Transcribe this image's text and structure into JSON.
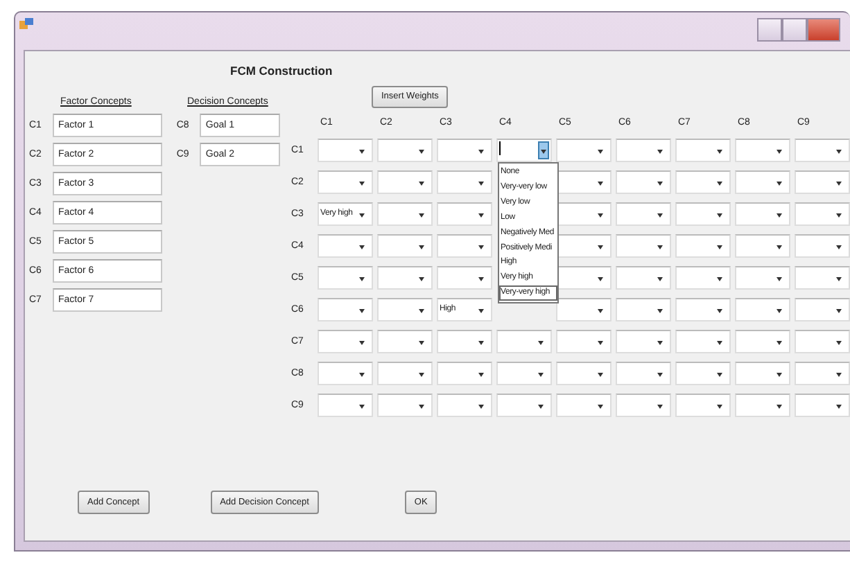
{
  "heading": "FCM Construction",
  "factor_concepts": {
    "header": "Factor Concepts",
    "items": [
      {
        "label": "C1",
        "value": "Factor 1"
      },
      {
        "label": "C2",
        "value": "Factor 2"
      },
      {
        "label": "C3",
        "value": "Factor 3"
      },
      {
        "label": "C4",
        "value": "Factor 4"
      },
      {
        "label": "C5",
        "value": "Factor 5"
      },
      {
        "label": "C6",
        "value": "Factor 6"
      },
      {
        "label": "C7",
        "value": "Factor 7"
      }
    ]
  },
  "decision_concepts": {
    "header": "Decision Concepts",
    "items": [
      {
        "label": "C8",
        "value": "Goal 1"
      },
      {
        "label": "C9",
        "value": "Goal 2"
      }
    ]
  },
  "weights": {
    "button": "Insert Weights",
    "columns": [
      "C1",
      "C2",
      "C3",
      "C4",
      "C5",
      "C6",
      "C7",
      "C8",
      "C9"
    ],
    "rows": [
      {
        "label": "C1",
        "cells": [
          {},
          {},
          {},
          {
            "open": true
          },
          {},
          {},
          {},
          {},
          {}
        ]
      },
      {
        "label": "C2",
        "cells": [
          {},
          {},
          {},
          null,
          {},
          {},
          {},
          {},
          {}
        ]
      },
      {
        "label": "C3",
        "cells": [
          {
            "value": "Very high"
          },
          {},
          {},
          null,
          {},
          {},
          {},
          {},
          {}
        ]
      },
      {
        "label": "C4",
        "cells": [
          {},
          {},
          {},
          null,
          {},
          {},
          {},
          {},
          {}
        ]
      },
      {
        "label": "C5",
        "cells": [
          {},
          {},
          {},
          null,
          {},
          {},
          {},
          {},
          {}
        ]
      },
      {
        "label": "C6",
        "cells": [
          {},
          {},
          {
            "value": "High"
          },
          null,
          {},
          {},
          {},
          {},
          {}
        ]
      },
      {
        "label": "C7",
        "cells": [
          {},
          {},
          {},
          {},
          {},
          {},
          {},
          {},
          {}
        ]
      },
      {
        "label": "C8",
        "cells": [
          {},
          {},
          {},
          {},
          {},
          {},
          {},
          {},
          {}
        ]
      },
      {
        "label": "C9",
        "cells": [
          {},
          {},
          {},
          {},
          {},
          {},
          {},
          {},
          {}
        ]
      }
    ],
    "dropdown_options": [
      {
        "label": "None",
        "selected": false
      },
      {
        "label": "Very-very low",
        "selected": false
      },
      {
        "label": "Very low",
        "selected": false
      },
      {
        "label": "Low",
        "selected": false
      },
      {
        "label": "Negatively Med",
        "selected": false
      },
      {
        "label": "Positively Medi",
        "selected": false
      },
      {
        "label": "High",
        "selected": false
      },
      {
        "label": "Very high",
        "selected": false
      },
      {
        "label": "Very-very high",
        "selected": true
      }
    ]
  },
  "buttons": [
    "Add Concept",
    "Add Decision Concept",
    "OK"
  ]
}
